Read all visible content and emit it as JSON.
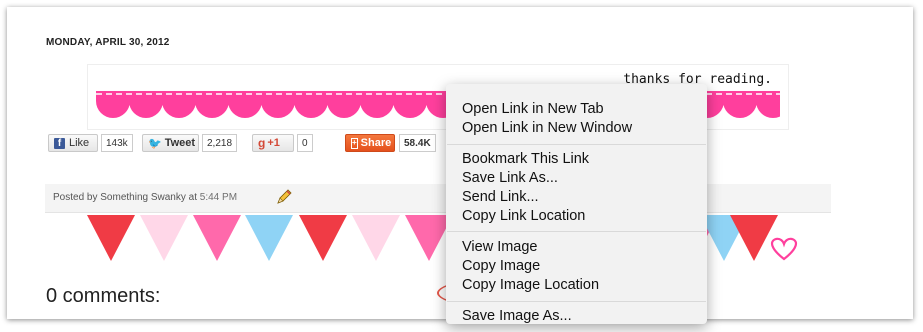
{
  "post": {
    "date": "MONDAY, APRIL 30, 2012",
    "banner_text": "thanks for reading."
  },
  "share_bar": {
    "facebook": {
      "label": "Like",
      "count": "143k",
      "icon": "facebook-icon"
    },
    "twitter": {
      "label": "Tweet",
      "count": "2,218",
      "icon": "twitter-icon"
    },
    "google": {
      "g": "g",
      "label": "+1",
      "count": "0",
      "icon": "google-plus-icon"
    },
    "share": {
      "label": "Share",
      "count": "58.4K",
      "icon": "share-icon"
    }
  },
  "footer": {
    "posted_by_prefix": "Posted by",
    "author": "Something Swanky",
    "at": "at",
    "time": "5:44 PM",
    "edit_icon": "pencil-icon"
  },
  "comments": {
    "title": "0 comments:"
  },
  "context_menu": {
    "items": [
      {
        "label": "Open Link in New Tab"
      },
      {
        "label": "Open Link in New Window"
      },
      {
        "label": "Bookmark This Link"
      },
      {
        "label": "Save Link As..."
      },
      {
        "label": "Send Link..."
      },
      {
        "label": "Copy Link Location"
      },
      {
        "label": "View Image"
      },
      {
        "label": "Copy Image"
      },
      {
        "label": "Copy Image Location"
      },
      {
        "label": "Save Image As..."
      }
    ]
  },
  "colors": {
    "scallop_pink": "#ff3f9d",
    "bunting_red": "#f03b45",
    "bunting_pink": "#ff69ab",
    "bunting_light_pink": "#ffd7e8",
    "bunting_blue": "#8fd3f5",
    "highlight_ring": "#e4584b"
  }
}
